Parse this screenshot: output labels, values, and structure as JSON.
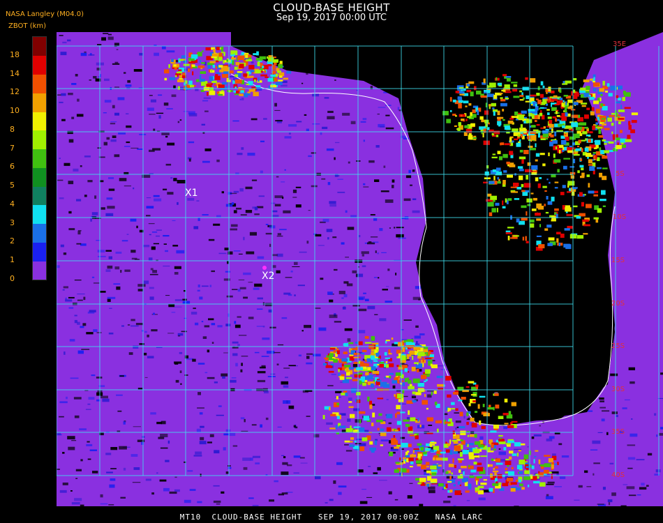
{
  "header": {
    "title": "CLOUD-BASE HEIGHT",
    "datetime": "Sep 19, 2017 00:00 UTC",
    "source": "NASA Langley (M04.0)",
    "units": "ZBOT (km)"
  },
  "colorbar": {
    "ticks": [
      "0",
      "1",
      "2",
      "3",
      "4",
      "5",
      "6",
      "7",
      "8",
      "10",
      "12",
      "14",
      "18"
    ],
    "colors": [
      "#8a30e0",
      "#1a20f0",
      "#1a70e8",
      "#10e0f0",
      "#108060",
      "#109020",
      "#40c010",
      "#a0f000",
      "#f0f000",
      "#f0a000",
      "#f05000",
      "#e00000",
      "#800000"
    ]
  },
  "map": {
    "markers": [
      {
        "label": "X1"
      },
      {
        "label": "X2"
      }
    ],
    "lat_labels": [
      "35E",
      "5S",
      "10S",
      "15S",
      "20S",
      "25S",
      "30S",
      "35S",
      "40S"
    ],
    "ocean_color": "#8a30e0",
    "land_color": "#000000",
    "grid_color": "#40e0f0"
  },
  "footer": "MT10  CLOUD-BASE HEIGHT   SEP 19, 2017 00:00Z   NASA LARC"
}
